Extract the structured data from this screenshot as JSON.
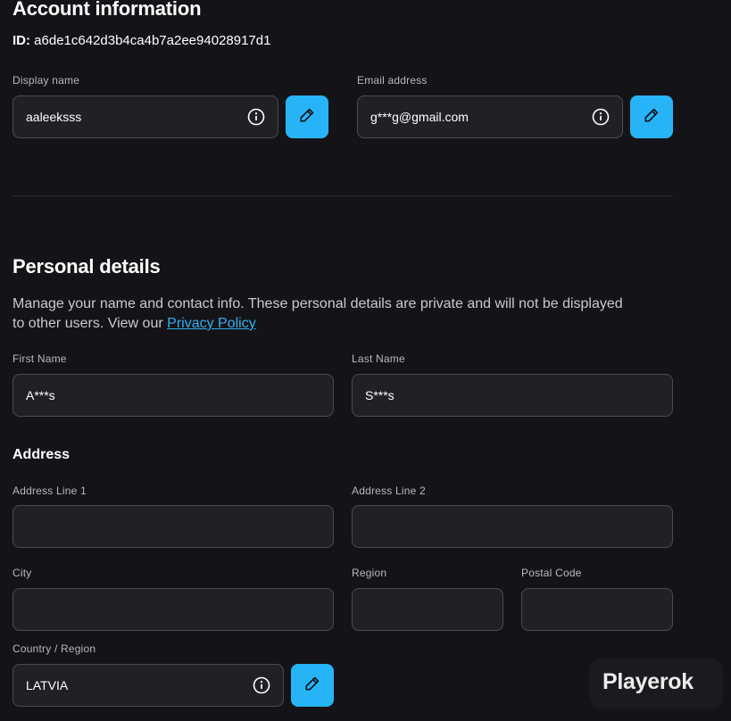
{
  "account": {
    "title": "Account information",
    "id_label": "ID:",
    "id_value": "a6de1c642d3b4ca4b7a2ee94028917d1",
    "display_name": {
      "label": "Display name",
      "value": "aaleeksss"
    },
    "email": {
      "label": "Email address",
      "value": "g***g@gmail.com"
    }
  },
  "personal": {
    "title": "Personal details",
    "description": "Manage your name and contact info. These personal details are private and will not be displayed to other users. View our",
    "privacy_link": "Privacy Policy",
    "first_name": {
      "label": "First Name",
      "value": "A***s"
    },
    "last_name": {
      "label": "Last Name",
      "value": "S***s"
    }
  },
  "address": {
    "title": "Address",
    "line1": {
      "label": "Address Line 1",
      "value": ""
    },
    "line2": {
      "label": "Address Line 2",
      "value": ""
    },
    "city": {
      "label": "City",
      "value": ""
    },
    "region": {
      "label": "Region",
      "value": ""
    },
    "postal": {
      "label": "Postal Code",
      "value": ""
    },
    "country": {
      "label": "Country / Region",
      "value": "LATVIA"
    }
  },
  "brand": {
    "name": "Playerok"
  },
  "icons": {
    "info": "info-icon",
    "edit": "pencil-icon"
  },
  "colors": {
    "accent": "#27b4f7",
    "link": "#2fb2f3",
    "background": "#141418"
  }
}
